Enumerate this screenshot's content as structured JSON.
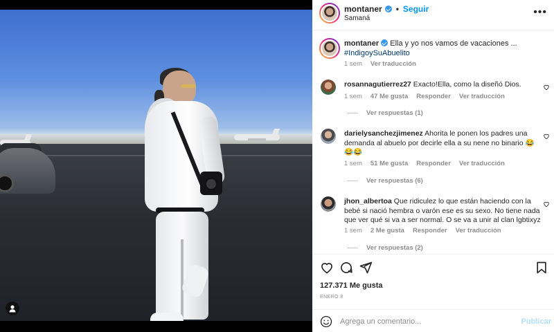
{
  "post": {
    "username": "montaner",
    "follow_label": "Seguir",
    "separator": "•",
    "location": "Samaná",
    "more_icon": "more-horizontal-icon"
  },
  "caption": {
    "username": "montaner",
    "text": "Ella y yo nos vamos de vacaciones ...",
    "hashtag": "#IndigoySuAbuelito",
    "time": "1 sem",
    "translate_label": "Ver traducción"
  },
  "comments": [
    {
      "username": "rosannagutierrez27",
      "text": "Exacto!Ella, como la diseñó Dios.",
      "time": "1 sem",
      "likes": "47 Me gusta",
      "reply_label": "Responder",
      "translate_label": "Ver traducción",
      "view_replies": "Ver respuestas (1)"
    },
    {
      "username": "darielysanchezjimenez",
      "text": "Ahorita le ponen los padres una demanda al abuelo por decirle ella a su nene no binario 😂😂😂",
      "time": "1 sem",
      "likes": "51 Me gusta",
      "reply_label": "Responder",
      "translate_label": "Ver traducción",
      "view_replies": "Ver respuestas (6)"
    },
    {
      "username": "jhon_albertoa",
      "text": "Que ridiculez lo que están haciendo con la bebé si nació hembra o varón ese es su sexo. No tiene nada que ver qué si va a ser normal. O se va a unir al clan lgbtixyz",
      "time": "1 sem",
      "likes": "2 Me gusta",
      "reply_label": "Responder",
      "translate_label": "Ver traducción",
      "view_replies": "Ver respuestas (2)"
    }
  ],
  "stats": {
    "likes": "127.371 Me gusta",
    "date": "ENERO 8"
  },
  "composer": {
    "placeholder": "Agrega un comentario...",
    "publish_label": "Publicar"
  },
  "colors": {
    "accent": "#0095f6",
    "verified": "#3897f0",
    "muted": "#8e8e8e",
    "publish_disabled": "#b2dffc"
  },
  "icons": [
    "verified-icon",
    "more-horizontal-icon",
    "heart-icon",
    "comment-icon",
    "share-icon",
    "bookmark-icon",
    "emoji-icon",
    "user-tag-icon"
  ]
}
